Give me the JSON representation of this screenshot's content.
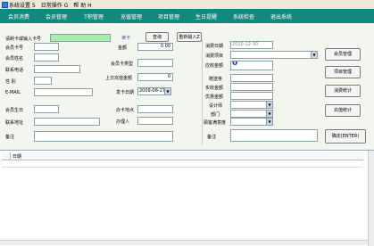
{
  "menu": {
    "items": [
      {
        "label": "系统设置 S"
      },
      {
        "label": "日常操作 G"
      },
      {
        "label": "帮  助 H"
      }
    ]
  },
  "toolbar": {
    "items": [
      "会员消费",
      "会员管理",
      "T积管理",
      "充值管理",
      "项目管理",
      "生日提醒",
      "系统检查",
      "退出系统"
    ]
  },
  "form": {
    "card_prompt": "请刷卡或输入卡号",
    "card_link": "读卡",
    "query_btn": "查询",
    "new_input_btn": "重新输入Z",
    "left": {
      "card_no": "会员卡号",
      "name": "会员姓名",
      "phone": "联系电话",
      "gender": "性    别",
      "email": "E-MAIL",
      "birthday": "会员生日",
      "address": "联系地址",
      "remark": "备注"
    },
    "mid": {
      "amount": "金额",
      "amount_value": "0.00",
      "card_type": "会员卡类型",
      "last_recharge": "上次充值金额",
      "last_recharge_value": "0",
      "issue_date": "发卡日期",
      "issue_date_value": "2009-08-27",
      "card_owner": "办卡地点",
      "handler": "办理人"
    },
    "right": {
      "consume_date": "消费日期",
      "consume_date_value": "2010-12-30",
      "consume_item": "消费项目",
      "due_amount": "应收金额",
      "due_value": "0",
      "coupon": "赠送劵",
      "actual_amount": "实收金额",
      "discount": "优惠金额",
      "designer": "设计师",
      "department": "部门",
      "receptionist": "顾客满意度",
      "remark": "备注"
    },
    "side_buttons": {
      "member_mgmt": "会员管理",
      "item_mgmt": "项目管理",
      "consume_stats": "消费统计",
      "recharge_stats": "充值统计",
      "confirm": "确定(ENTER)"
    }
  },
  "grid": {
    "columns": [
      "日期"
    ]
  }
}
